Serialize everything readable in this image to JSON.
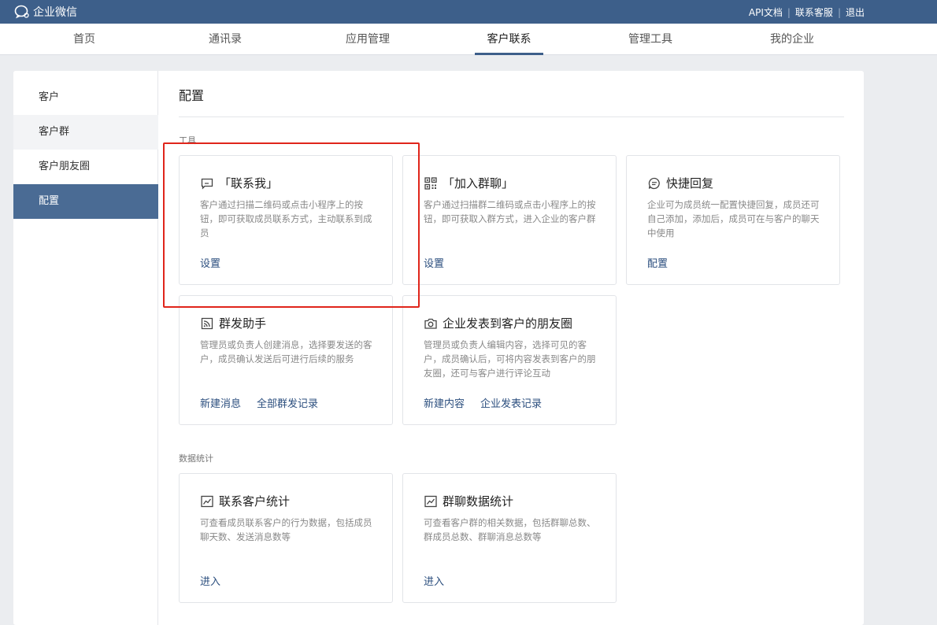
{
  "app": {
    "logo_text": "企业微信",
    "links": [
      "API文档",
      "联系客服",
      "退出"
    ]
  },
  "nav": {
    "tabs": [
      "首页",
      "通讯录",
      "应用管理",
      "客户联系",
      "管理工具",
      "我的企业"
    ],
    "active": "客户联系"
  },
  "sidebar": {
    "items": [
      "客户",
      "客户群",
      "客户朋友圈",
      "配置"
    ],
    "active": "配置"
  },
  "main": {
    "title": "配置",
    "sections": {
      "tools_label": "工具",
      "stats_label": "数据统计"
    },
    "cards": [
      {
        "icon": "message-square-icon",
        "title": "「联系我」",
        "desc": "客户通过扫描二维码或点击小程序上的按钮，即可获取成员联系方式，主动联系到成员",
        "actions": [
          "设置"
        ]
      },
      {
        "icon": "qr-code-icon",
        "title": "「加入群聊」",
        "desc": "客户通过扫描群二维码或点击小程序上的按钮，即可获取入群方式，进入企业的客户群",
        "actions": [
          "设置"
        ]
      },
      {
        "icon": "quick-reply-icon",
        "title": "快捷回复",
        "desc": "企业可为成员统一配置快捷回复，成员还可自己添加，添加后，成员可在与客户的聊天中使用",
        "actions": [
          "配置"
        ]
      },
      {
        "icon": "broadcast-icon",
        "title": "群发助手",
        "desc": "管理员或负责人创建消息，选择要发送的客户，成员确认发送后可进行后续的服务",
        "actions": [
          "新建消息",
          "全部群发记录"
        ]
      },
      {
        "icon": "camera-icon",
        "title": "企业发表到客户的朋友圈",
        "desc": "管理员或负责人编辑内容，选择可见的客户，成员确认后，可将内容发表到客户的朋友圈，还可与客户进行评论互动",
        "actions": [
          "新建内容",
          "企业发表记录"
        ]
      },
      {
        "icon": "line-chart-icon",
        "title": "联系客户统计",
        "desc": "可查看成员联系客户的行为数据，包括成员聊天数、发送消息数等",
        "actions": [
          "进入"
        ]
      },
      {
        "icon": "line-chart-icon",
        "title": "群聊数据统计",
        "desc": "可查看客户群的相关数据，包括群聊总数、群成员总数、群聊消息总数等",
        "actions": [
          "进入"
        ]
      }
    ]
  },
  "colors": {
    "topbar": "#3d5f8a",
    "active_sidebar": "#4a6b94",
    "link": "#2b4e7e",
    "highlight": "#e0251b"
  }
}
